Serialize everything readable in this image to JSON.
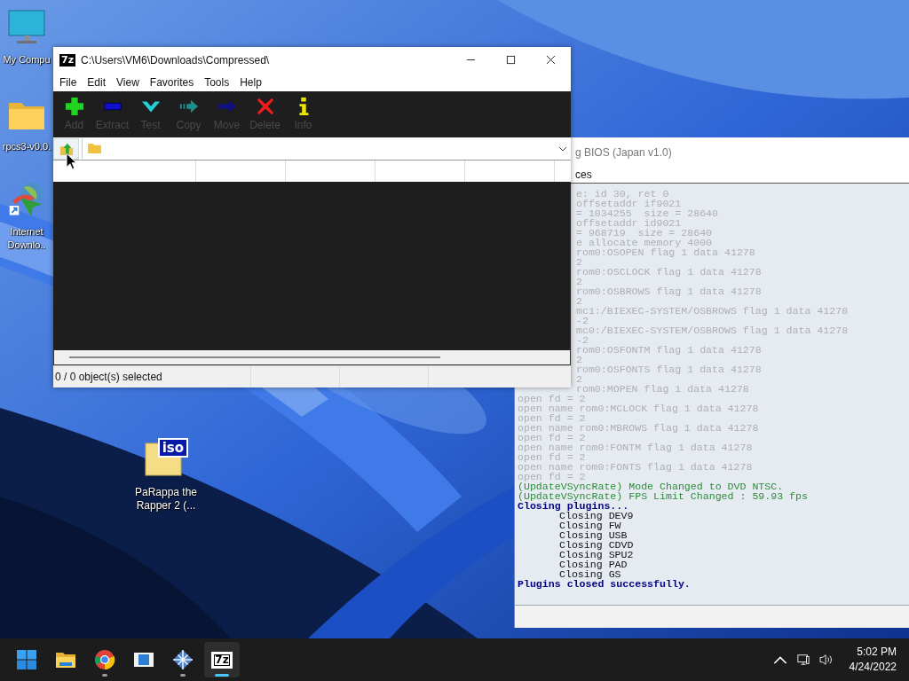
{
  "desktop_icons": [
    {
      "kind": "monitor",
      "label": [
        "My Compu"
      ]
    },
    {
      "kind": "folder",
      "label": [
        "rpcs3-v0.0."
      ]
    },
    {
      "kind": "download-manager",
      "label": [
        "Internet",
        "Downlo.."
      ]
    },
    {
      "kind": "iso",
      "badge": "iso",
      "label": [
        "PaRappa the",
        "Rapper 2 (..."
      ]
    }
  ],
  "console_window": {
    "title": "g BIOS (Japan v1.0)",
    "menu": [
      "ces"
    ],
    "log": [
      {
        "text": "e: id 30, ret 0",
        "kind": "faded",
        "cut": true
      },
      {
        "text": "offsetaddr if9021",
        "kind": "faded",
        "cut": true
      },
      {
        "text": "= 1034255  size = 28640",
        "kind": "faded",
        "cut": true
      },
      {
        "text": "offsetaddr id9021",
        "kind": "faded",
        "cut": true
      },
      {
        "text": "= 968719  size = 28640",
        "kind": "faded",
        "cut": true
      },
      {
        "text": "e allocate memory 4000",
        "kind": "faded",
        "cut": true
      },
      {
        "text": "rom0:OSOPEN flag 1 data 41278",
        "kind": "faded",
        "cut": true
      },
      {
        "text": "2",
        "kind": "faded",
        "cut": true
      },
      {
        "text": "rom0:OSCLOCK flag 1 data 41278",
        "kind": "faded",
        "cut": true
      },
      {
        "text": "2",
        "kind": "faded",
        "cut": true
      },
      {
        "text": "rom0:OSBROWS flag 1 data 41278",
        "kind": "faded",
        "cut": true
      },
      {
        "text": "2",
        "kind": "faded",
        "cut": true
      },
      {
        "text": "mc1:/BIEXEC-SYSTEM/OSBROWS flag 1 data 41278",
        "kind": "faded",
        "cut": true
      },
      {
        "text": "-2",
        "kind": "faded",
        "cut": true
      },
      {
        "text": "mc0:/BIEXEC-SYSTEM/OSBROWS flag 1 data 41278",
        "kind": "faded",
        "cut": true
      },
      {
        "text": "-2",
        "kind": "faded",
        "cut": true
      },
      {
        "text": "rom0:OSFONTM flag 1 data 41278",
        "kind": "faded",
        "cut": true
      },
      {
        "text": "2",
        "kind": "faded",
        "cut": true
      },
      {
        "text": "rom0:OSFONTS flag 1 data 41278",
        "kind": "faded",
        "cut": true
      },
      {
        "text": "2",
        "kind": "faded",
        "cut": true
      },
      {
        "text": "rom0:MOPEN flag 1 data 41278",
        "kind": "faded",
        "cut": true
      },
      {
        "text": "open fd = 2",
        "kind": "faded",
        "cut": false
      },
      {
        "text": "open name rom0:MCLOCK flag 1 data 41278",
        "kind": "faded",
        "cut": false
      },
      {
        "text": "open fd = 2",
        "kind": "faded",
        "cut": false
      },
      {
        "text": "open name rom0:MBROWS flag 1 data 41278",
        "kind": "faded",
        "cut": false
      },
      {
        "text": "open fd = 2",
        "kind": "faded",
        "cut": false
      },
      {
        "text": "open name rom0:FONTM flag 1 data 41278",
        "kind": "faded",
        "cut": false
      },
      {
        "text": "open fd = 2",
        "kind": "faded",
        "cut": false
      },
      {
        "text": "open name rom0:FONTS flag 1 data 41278",
        "kind": "faded",
        "cut": false
      },
      {
        "text": "open fd = 2",
        "kind": "faded",
        "cut": false
      },
      {
        "text": "(UpdateVSyncRate) Mode Changed to DVD NTSC.",
        "kind": "info",
        "cut": false
      },
      {
        "text": "(UpdateVSyncRate) FPS Limit Changed : 59.93 fps",
        "kind": "info",
        "cut": false
      },
      {
        "text": "Closing plugins...",
        "kind": "header",
        "cut": false
      },
      {
        "text": "Closing DEV9",
        "kind": "detail",
        "cut": false
      },
      {
        "text": "Closing FW",
        "kind": "detail",
        "cut": false
      },
      {
        "text": "Closing USB",
        "kind": "detail",
        "cut": false
      },
      {
        "text": "Closing CDVD",
        "kind": "detail",
        "cut": false
      },
      {
        "text": "Closing SPU2",
        "kind": "detail",
        "cut": false
      },
      {
        "text": "Closing PAD",
        "kind": "detail",
        "cut": false
      },
      {
        "text": "Closing GS",
        "kind": "detail",
        "cut": false
      },
      {
        "text": "Plugins closed successfully.",
        "kind": "header",
        "cut": false
      }
    ]
  },
  "archive_window": {
    "icon_text": "7z",
    "title": "C:\\Users\\VM6\\Downloads\\Compressed\\",
    "menu": [
      "File",
      "Edit",
      "View",
      "Favorites",
      "Tools",
      "Help"
    ],
    "toolbar": [
      {
        "label": "Add",
        "kind": "add"
      },
      {
        "label": "Extract",
        "kind": "extract"
      },
      {
        "label": "Test",
        "kind": "test"
      },
      {
        "label": "Copy",
        "kind": "copy"
      },
      {
        "label": "Move",
        "kind": "move"
      },
      {
        "label": "Delete",
        "kind": "delete"
      },
      {
        "label": "Info",
        "kind": "info"
      }
    ],
    "status": "0 / 0 object(s) selected"
  },
  "taskbar": {
    "apps": [
      {
        "kind": "start",
        "running": false,
        "active": false
      },
      {
        "kind": "folder",
        "running": false,
        "active": false
      },
      {
        "kind": "chrome",
        "running": true,
        "active": false
      },
      {
        "kind": "media",
        "running": false,
        "active": false
      },
      {
        "kind": "diamond",
        "running": true,
        "active": false
      },
      {
        "kind": "sevenzip",
        "icon_text": "7z",
        "running": true,
        "active": true
      }
    ],
    "clock": {
      "time": "5:02 PM",
      "date": "4/24/2022"
    }
  }
}
